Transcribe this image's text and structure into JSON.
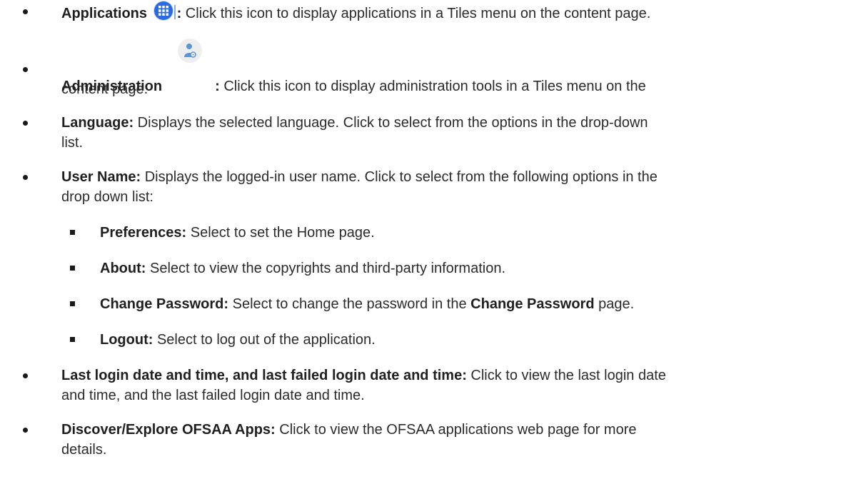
{
  "items": [
    {
      "term": "Applications",
      "sep": ":",
      "icon": "applications-grid-icon",
      "text": " Click this icon to display applications in a Tiles menu on the content page."
    },
    {
      "term": "Administration",
      "sep": ":",
      "icon": "administration-user-gear-icon",
      "text": " Click this icon to display administration tools in a Tiles menu on the",
      "text2": "content page."
    },
    {
      "term": "Language:",
      "text": " Displays the selected language. Click to select from the options in the drop-down",
      "text2": "list."
    },
    {
      "term": "User Name:",
      "text": " Displays the logged-in user name. Click to select from the following options in the",
      "text2": "drop down list:"
    },
    {
      "term": "Last login date and time, and last failed login date and time:",
      "text": " Click to view the last login date",
      "text2": "and time, and the last failed login date and time."
    },
    {
      "term": "Discover/Explore OFSAA Apps:",
      "text": " Click to view the OFSAA applications web page for more",
      "text2": "details."
    }
  ],
  "subitems": [
    {
      "term": "Preferences:",
      "text": " Select to set the Home page."
    },
    {
      "term": "About:",
      "text": " Select to view the copyrights and third-party information."
    },
    {
      "term": "Change Password:",
      "text": " Select to change the password in the ",
      "term2": "Change Password",
      "text2": " page."
    },
    {
      "term": "Logout:",
      "text": " Select to log out of the application."
    }
  ],
  "colors": {
    "applications_icon": "#2a6be0",
    "admin_icon_bg": "#eeeeee",
    "admin_icon_figure": "#5b95d9"
  }
}
